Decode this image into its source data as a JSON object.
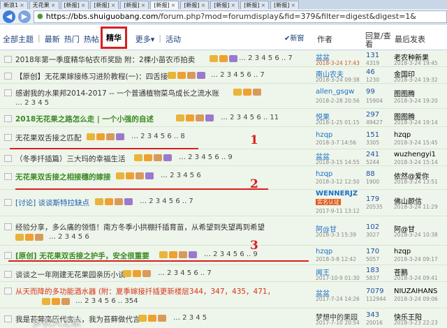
{
  "browser": {
    "tabs": [
      {
        "label": "新浪1",
        "active": false
      },
      {
        "label": "无花果",
        "active": false
      },
      {
        "label": "[新报]",
        "active": false
      },
      {
        "label": "[新报]",
        "active": false
      },
      {
        "label": "[新报]",
        "active": false
      },
      {
        "label": "[新报]",
        "active": true
      },
      {
        "label": "[新报]",
        "active": false
      },
      {
        "label": "[新报]",
        "active": false
      },
      {
        "label": "[新报]",
        "active": false
      },
      {
        "label": "[新报]",
        "active": false
      }
    ],
    "url_host": "https://bbs.shuiguobang.com",
    "url_path": "/forum.php?mod=forumdisplay&fid=379&filter=digest&digest=1&"
  },
  "filters": {
    "items": [
      "全部主题",
      "最新",
      "热门",
      "热帖",
      "精华",
      "更多",
      "活动"
    ],
    "more_arrow": "▾",
    "new_window": "新窗"
  },
  "columns": {
    "author": "作者",
    "reply_view": "回复/查看",
    "last_post": "最后发表"
  },
  "threads": [
    {
      "title": "2018年第一季度精华帖农币奖励 附：2棵小苗农币拍卖",
      "pages": "… 2 3 4 5 6 .. 7",
      "author": "盆盆",
      "date": "2018-3-24 17:43",
      "replies": "131",
      "views": "4319",
      "last": "老农种新果",
      "ldate": "2018-3-24 19:45"
    },
    {
      "title": "【原创】无花果嫁接练习进阶教程(一)：四舌接",
      "pages": "… 2 3 4 5 6 .. 7",
      "author": "南山农夫",
      "date": "2018-3-24 09:38",
      "replies": "46",
      "views": "1230",
      "last": "金国印",
      "ldate": "2018-3-24 19:32"
    },
    {
      "title": "感谢我的水果邦2014-2017 -- 一个普通植物菜鸟成长之流水账",
      "pages": "… 2 3 4 5",
      "author": "allen_gsgw",
      "date": "2018-2-28 20:56",
      "replies": "99",
      "views": "15904",
      "last": "图图腾",
      "ldate": "2018-3-24 19:20"
    },
    {
      "title": "2018无花果之路怎么走 | 一个小强的自述",
      "pages": "… 2 3 4 5 6 .. 11",
      "author": "悦果",
      "date": "2018-1-25 01:15",
      "replies": "297",
      "views": "49427",
      "last": "图图腾",
      "ldate": "2018-3-24 19:14"
    },
    {
      "title": "无花果双舌接之匹配",
      "pages": "… 2 3 4 5 6 .. 8",
      "author": "hzqp",
      "date": "2018-3-7 14:56",
      "replies": "151",
      "views": "3305",
      "last": "hzqp",
      "ldate": "2018-3-24 15:45"
    },
    {
      "title": "（冬季扦插篇）三大玛的幸福生活",
      "pages": "… 2 3 4 5 6 .. 9",
      "author": "盆盆",
      "date": "2018-3-15 14:55",
      "replies": "241",
      "views": "5244",
      "last": "wuzhengyi1",
      "ldate": "2018-3-24 15:14"
    },
    {
      "title": "无花果双舌接之相接穗的嫁接",
      "pages": "… 2 3 4 5 6",
      "author": "hzqp",
      "date": "2018-3-12 12:50",
      "replies": "88",
      "views": "1900",
      "last": "依然@爱你",
      "ldate": "2018-3-24 13:51"
    },
    {
      "title": "[讨论] 谈谈斯特拉缺点",
      "pages": "… 2 3 4 5 6 .. 7",
      "author": "WENNERJZ",
      "vip": "实名认证",
      "date": "2017-9-11 13:12",
      "replies": "179",
      "views": "20535",
      "last": "佛山颜信",
      "ldate": "2018-3-24 11:29"
    },
    {
      "title": "经验分享，多么痛的领悟！南方冬季小拱棚扦插育苗，从希望到失望再到希望",
      "pages": "… 2 3 4 5 6",
      "author": "阿@甘",
      "date": "2018-3-3 15:39",
      "replies": "102",
      "views": "3027",
      "last": "阿@甘",
      "ldate": "2018-3-24 10:38"
    },
    {
      "title": "[原创] 无花果双舌接之护手，安全很重要",
      "pages": "… 2 3 4 5 6 .. 9",
      "author": "hzqp",
      "date": "2018-3-8 12:42",
      "replies": "170",
      "views": "5057",
      "last": "hzqp",
      "ldate": "2018-3-24 09:17"
    },
    {
      "title": "谈谈之一年刚建无花果园亲历小谈",
      "pages": "… 2 3 4 5 6 .. 7",
      "author": "闻王",
      "date": "2017-10-9 01:30",
      "replies": "183",
      "views": "5837",
      "last": "苍鹏",
      "ldate": "2018-3-24 09:41"
    },
    {
      "title": "从天而降的多功能酒水器 (附：夏季嫁接扦插更新楼层344，347，435，471，",
      "pages": "… 2 3 4 5 6 .. 354",
      "author": "盆盆",
      "date": "2017-7-24 14:26",
      "replies": "7079",
      "views": "112944",
      "last": "NIUZAIHANS",
      "ldate": "2018-3-24 09:06"
    },
    {
      "title": "我是苔藓高压代言人，我为苔藓做代言",
      "pages": "… 2 3 4 5",
      "author": "梦想中的果园",
      "date": "2017-7-10 20:54",
      "replies": "343",
      "views": "20016",
      "last": "快乐王阳",
      "ldate": "2018-3-23 22:23"
    }
  ],
  "annotations": [
    "1",
    "2",
    "3"
  ],
  "watermark": "多农人之家"
}
